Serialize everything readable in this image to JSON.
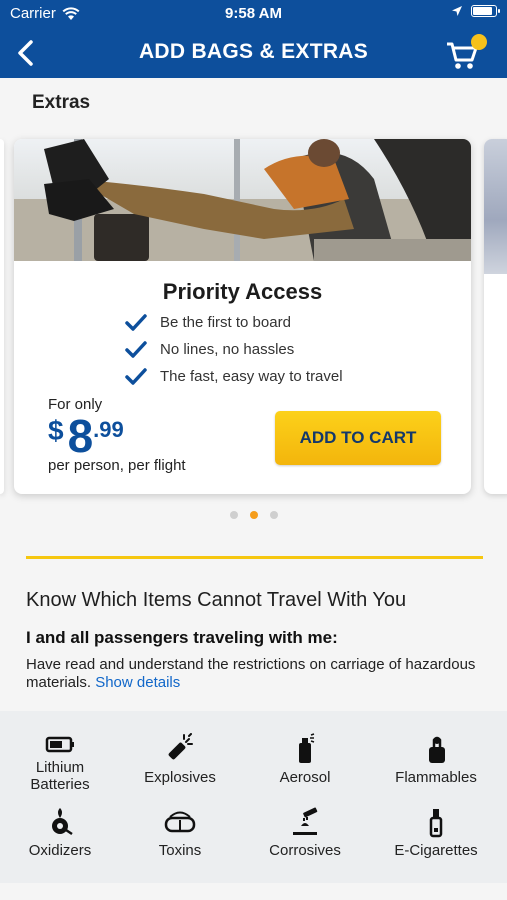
{
  "status_bar": {
    "carrier": "Carrier",
    "time": "9:58 AM",
    "battery_percent": 95
  },
  "nav": {
    "title": "ADD BAGS & EXTRAS",
    "back_icon": "chevron-left-icon",
    "cart_icon": "shopping-cart-icon",
    "cart_badge_color": "#f6c11b"
  },
  "section": {
    "label": "Extras"
  },
  "offer": {
    "title": "Priority Access",
    "benefits": [
      "Be the first to board",
      "No lines, no hassles",
      "The fast, easy way to travel"
    ],
    "price_prefix": "For only",
    "currency": "$",
    "price_integer": "8",
    "price_decimal": ".99",
    "price_suffix": "per person, per flight",
    "button_label": "ADD TO CART"
  },
  "carousel": {
    "page_count": 3,
    "active_index": 1
  },
  "restrictions": {
    "title": "Know Which Items Cannot Travel With You",
    "subtitle": "I and all passengers traveling with me:",
    "body": "Have read and understand the restrictions on carriage of hazardous materials.",
    "link": "Show details"
  },
  "items": [
    {
      "label": "Lithium\nBatteries",
      "icon": "battery-icon"
    },
    {
      "label": "Explosives",
      "icon": "firecracker-icon"
    },
    {
      "label": "Aerosol",
      "icon": "spray-can-icon"
    },
    {
      "label": "Flammables",
      "icon": "lighter-icon"
    },
    {
      "label": "Oxidizers",
      "icon": "oxidizer-icon"
    },
    {
      "label": "Toxins",
      "icon": "goggles-icon"
    },
    {
      "label": "Corrosives",
      "icon": "corrosive-icon"
    },
    {
      "label": "E-Cigarettes",
      "icon": "e-cigarette-icon"
    }
  ],
  "colors": {
    "brand_blue": "#0d4f9c",
    "accent_yellow": "#f6c70f",
    "link_blue": "#1167c9",
    "dot_active": "#f59d1b"
  }
}
